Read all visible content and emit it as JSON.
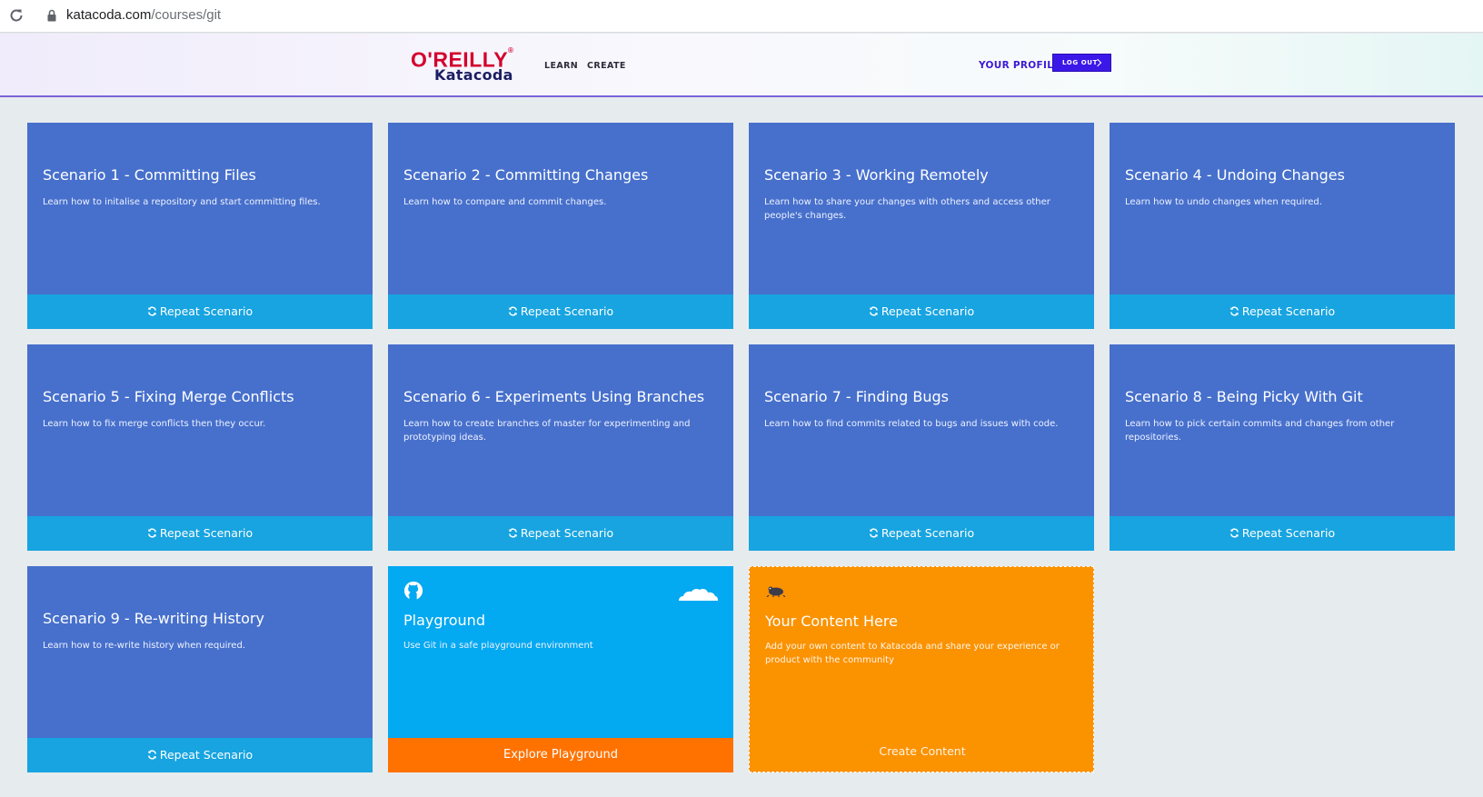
{
  "browser": {
    "url_domain": "katacoda.com",
    "url_path": "/courses/git"
  },
  "header": {
    "logo_top": "O'REILLY",
    "logo_bottom": "Katacoda",
    "nav": [
      {
        "label": "LEARN"
      },
      {
        "label": "CREATE"
      }
    ],
    "profile_label": "YOUR PROFILE",
    "logout_label": "LOG OUT"
  },
  "colors": {
    "scenario_bg": "#4770cc",
    "scenario_footer": "#17a4e0",
    "playground_bg": "#03a9f1",
    "playground_footer": "#ff7200",
    "content_bg": "#fb9200",
    "accent": "#3c18e8"
  },
  "scenarios": [
    {
      "title": "Scenario 1 - Committing Files",
      "description": "Learn how to initalise a repository and start committing files.",
      "action": "Repeat Scenario"
    },
    {
      "title": "Scenario 2 - Committing Changes",
      "description": "Learn how to compare and commit changes.",
      "action": "Repeat Scenario"
    },
    {
      "title": "Scenario 3 - Working Remotely",
      "description": "Learn how to share your changes with others and access other people's changes.",
      "action": "Repeat Scenario"
    },
    {
      "title": "Scenario 4 - Undoing Changes",
      "description": "Learn how to undo changes when required.",
      "action": "Repeat Scenario"
    },
    {
      "title": "Scenario 5 - Fixing Merge Conflicts",
      "description": "Learn how to fix merge conflicts then they occur.",
      "action": "Repeat Scenario"
    },
    {
      "title": "Scenario 6 - Experiments Using Branches",
      "description": "Learn how to create branches of master for experimenting and prototyping ideas.",
      "action": "Repeat Scenario"
    },
    {
      "title": "Scenario 7 - Finding Bugs",
      "description": "Learn how to find commits related to bugs and issues with code.",
      "action": "Repeat Scenario"
    },
    {
      "title": "Scenario 8 - Being Picky With Git",
      "description": "Learn how to pick certain commits and changes from other repositories.",
      "action": "Repeat Scenario"
    },
    {
      "title": "Scenario 9 - Re-writing History",
      "description": "Learn how to re-write history when required.",
      "action": "Repeat Scenario"
    }
  ],
  "playground": {
    "title": "Playground",
    "description": "Use Git in a safe playground environment",
    "action": "Explore Playground"
  },
  "content_card": {
    "title": "Your Content Here",
    "description": "Add your own content to Katacoda and share your experience or product with the community",
    "action": "Create Content"
  }
}
